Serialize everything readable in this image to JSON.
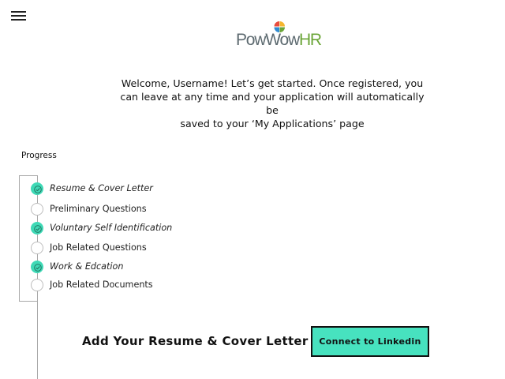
{
  "header": {
    "menu_icon": "hamburger-menu-icon",
    "logo": {
      "part1": "PowWow",
      "part2": "HR",
      "colors": {
        "part1": "#5d6a70",
        "part2": "#6ba538",
        "mark": [
          "#e84c3d",
          "#f5b52e",
          "#2f8ad1",
          "#6ba538"
        ]
      }
    }
  },
  "welcome": {
    "lines": [
      "Welcome, Username! Let’s get started. Once registered, you",
      "can leave at any time and your application will automatically be",
      "saved to your ‘My Applications’ page"
    ]
  },
  "progress": {
    "title": "Progress",
    "steps": [
      {
        "label": "Resume & Cover Letter",
        "complete": true
      },
      {
        "label": "Preliminary Questions",
        "complete": false
      },
      {
        "label": "Voluntary Self Identification",
        "complete": true
      },
      {
        "label": "Job Related Questions",
        "complete": false
      },
      {
        "label": "Work & Edcation",
        "complete": true
      },
      {
        "label": "Job Related Documents",
        "complete": false
      }
    ],
    "colors": {
      "complete": "#3fd9b6",
      "incomplete_border": "#bdbdbd"
    }
  },
  "cta": {
    "text": "Add Your Resume & Cover Letter or",
    "button_label": "Connect to Linkedin",
    "button_color": "#47e2bf"
  }
}
